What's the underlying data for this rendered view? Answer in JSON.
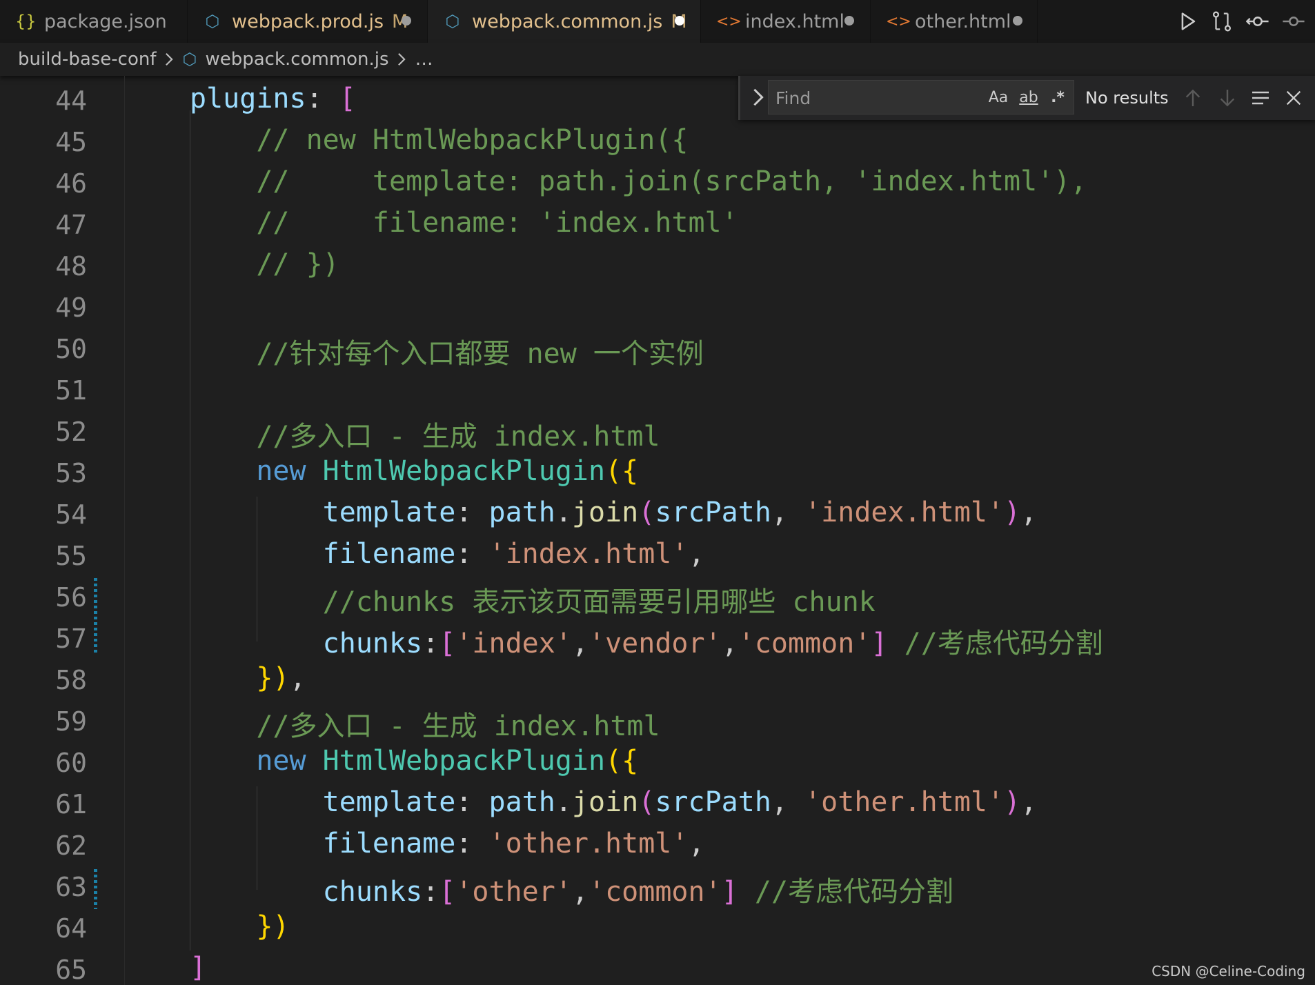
{
  "tabs": [
    {
      "icon": "{}",
      "label": "package.json",
      "modified": false,
      "dirty": false
    },
    {
      "icon": "⬡",
      "label": "webpack.prod.js",
      "modified": true,
      "dirty": true
    },
    {
      "icon": "⬡",
      "label": "webpack.common.js",
      "modified": true,
      "dirty": true,
      "active": true
    },
    {
      "icon": "<>",
      "label": "index.html",
      "modified": false,
      "dirty": true
    },
    {
      "icon": "<>",
      "label": "other.html",
      "modified": false,
      "dirty": true
    }
  ],
  "modified_marker": "M",
  "breadcrumb": {
    "folder": "build-base-conf",
    "file": "webpack.common.js",
    "more": "…"
  },
  "find": {
    "placeholder": "Find",
    "match_case": "Aa",
    "whole_word": "ab",
    "regex": ".*",
    "results": "No results"
  },
  "line_numbers": [
    "44",
    "45",
    "46",
    "47",
    "48",
    "49",
    "50",
    "51",
    "52",
    "53",
    "54",
    "55",
    "56",
    "57",
    "58",
    "59",
    "60",
    "61",
    "62",
    "63",
    "64",
    "65"
  ],
  "code": {
    "l44": "plugins",
    "l45": "// new HtmlWebpackPlugin({",
    "l46": "//     template: path.join(srcPath, 'index.html'),",
    "l47": "//     filename: 'index.html'",
    "l48": "// })",
    "l50": "//针对每个入口都要 new 一个实例",
    "l52": "//多入口 - 生成 index.html",
    "kw_new": "new",
    "cls": "HtmlWebpackPlugin",
    "template": "template",
    "path": "path",
    "join": "join",
    "srcPath": "srcPath",
    "str_index_html": "'index.html'",
    "filename": "filename",
    "l56": "//chunks 表示该页面需要引用哪些 chunk",
    "chunks": "chunks",
    "str_index": "'index'",
    "str_vendor": "'vendor'",
    "str_common": "'common'",
    "cmt_split": "//考虑代码分割",
    "l59": "//多入口 - 生成 index.html",
    "str_other_html": "'other.html'",
    "str_other": "'other'"
  },
  "watermark": "CSDN @Celine-Coding"
}
